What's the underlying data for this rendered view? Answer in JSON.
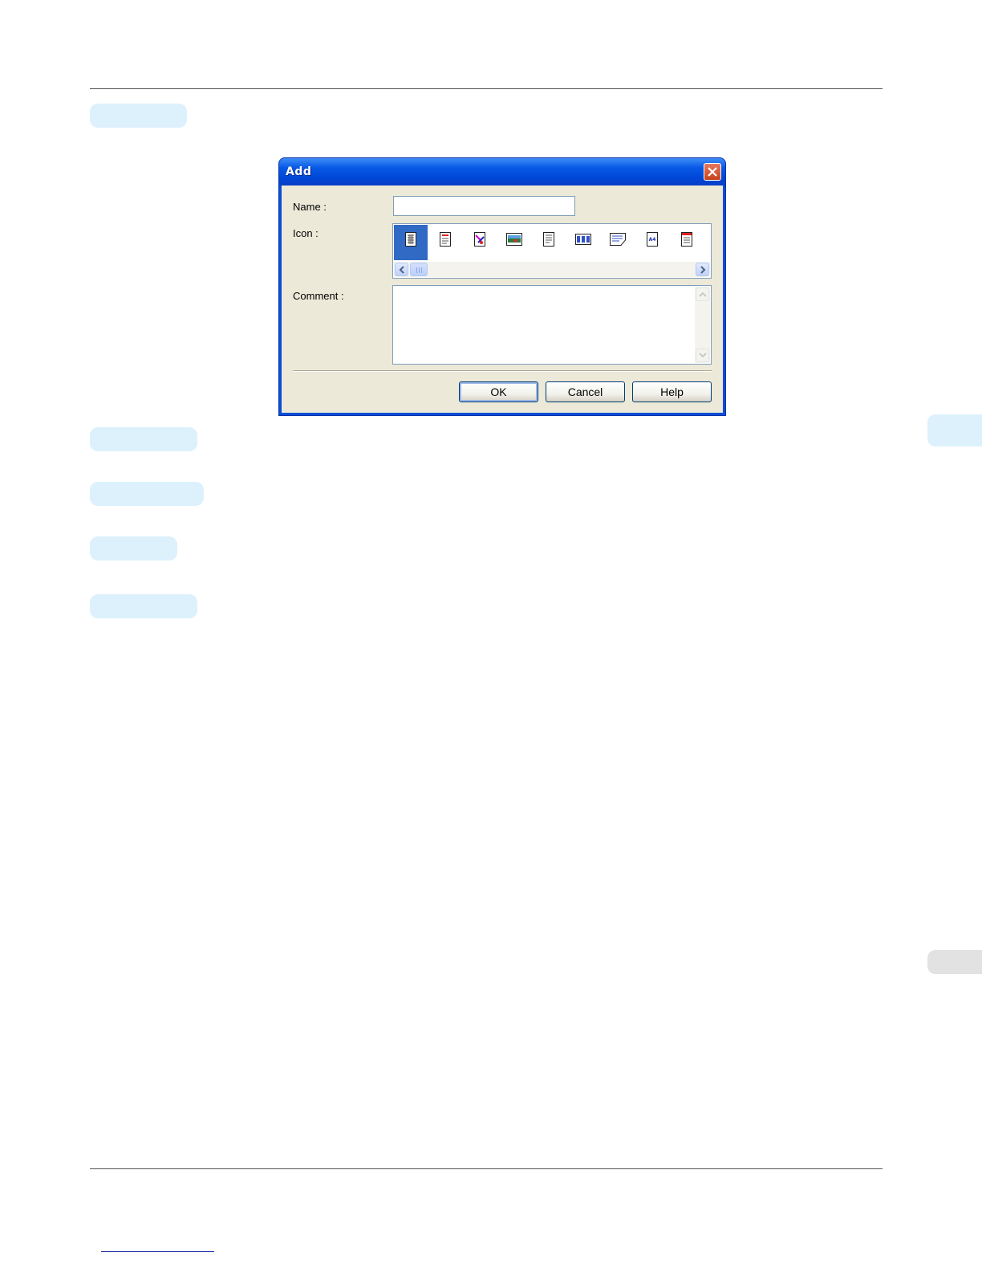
{
  "dialog": {
    "title": "Add",
    "name_label": "Name :",
    "name_value": "",
    "icon_label": "Icon :",
    "comment_label": "Comment :",
    "comment_value": "",
    "buttons": {
      "ok": "OK",
      "cancel": "Cancel",
      "help": "Help"
    },
    "icons": [
      {
        "name": "document-grid-icon",
        "selected": true
      },
      {
        "name": "document-red-lines-icon",
        "selected": false
      },
      {
        "name": "document-graphics-icon",
        "selected": false
      },
      {
        "name": "document-photo-icon",
        "selected": false
      },
      {
        "name": "document-lines-icon",
        "selected": false
      },
      {
        "name": "document-table-icon",
        "selected": false
      },
      {
        "name": "document-landscape-icon",
        "selected": false
      },
      {
        "name": "document-a4-icon",
        "selected": false
      },
      {
        "name": "document-red-header-icon",
        "selected": false
      }
    ],
    "colors": {
      "titlebar": "#0054e3",
      "selection": "#316ac5",
      "face": "#ece9d8"
    }
  },
  "page": {
    "accent_pill_color": "#ddf1fc",
    "side_tab_gray": "#e2e2e2"
  }
}
